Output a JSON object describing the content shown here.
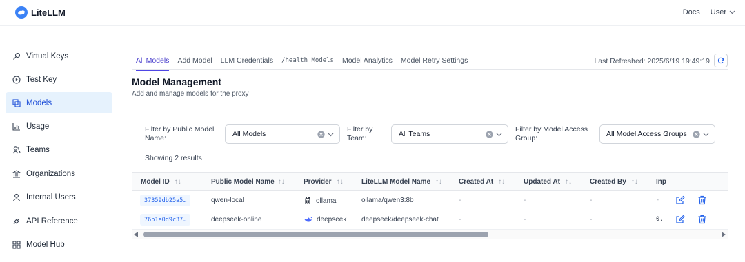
{
  "app": {
    "name": "LiteLLM"
  },
  "topnav": {
    "docs": "Docs",
    "user": "User"
  },
  "sidebar": {
    "items": [
      {
        "label": "Virtual Keys",
        "icon": "key-icon"
      },
      {
        "label": "Test Key",
        "icon": "play-circle-icon"
      },
      {
        "label": "Models",
        "icon": "models-icon",
        "active": true
      },
      {
        "label": "Usage",
        "icon": "bar-chart-icon"
      },
      {
        "label": "Teams",
        "icon": "team-icon"
      },
      {
        "label": "Organizations",
        "icon": "bank-icon"
      },
      {
        "label": "Internal Users",
        "icon": "user-icon"
      },
      {
        "label": "API Reference",
        "icon": "api-icon"
      },
      {
        "label": "Model Hub",
        "icon": "grid-icon"
      }
    ]
  },
  "tabs": [
    {
      "label": "All Models",
      "active": true
    },
    {
      "label": "Add Model"
    },
    {
      "label": "LLM Credentials"
    },
    {
      "label": "/health Models",
      "mono": true
    },
    {
      "label": "Model Analytics"
    },
    {
      "label": "Model Retry Settings"
    }
  ],
  "refresh": {
    "text": "Last Refreshed: 2025/6/19 19:49:19"
  },
  "page": {
    "title": "Model Management",
    "subtitle": "Add and manage models for the proxy"
  },
  "filters": {
    "public_model": {
      "label_line1": "Filter by Public Model",
      "label_line2": "Name:",
      "value": "All Models"
    },
    "team": {
      "label_line1": "Filter by",
      "label_line2": "Team:",
      "value": "All Teams"
    },
    "access_group": {
      "label_line1": "Filter by Model Access",
      "label_line2": "Group:",
      "value": "All Model Access Groups"
    }
  },
  "showing": "Showing 2 results",
  "table": {
    "headers": [
      "Model ID",
      "Public Model Name",
      "Provider",
      "LiteLLM Model Name",
      "Created At",
      "Updated At",
      "Created By",
      "Inp"
    ],
    "rows": [
      {
        "id": "37359db25a5…",
        "public_name": "qwen-local",
        "provider": "ollama",
        "provider_icon": "ollama-icon",
        "litellm_name": "ollama/qwen3:8b",
        "created_at": "-",
        "updated_at": "-",
        "created_by": "-",
        "input": "-"
      },
      {
        "id": "76b1e0d9c37…",
        "public_name": "deepseek-online",
        "provider": "deepseek",
        "provider_icon": "deepseek-whale-icon",
        "litellm_name": "deepseek/deepseek-chat",
        "created_at": "-",
        "updated_at": "-",
        "created_by": "-",
        "input": "0."
      }
    ]
  },
  "colors": {
    "accent": "#4f46e5",
    "active_bg": "#e6f2fd",
    "link": "#2563eb"
  }
}
